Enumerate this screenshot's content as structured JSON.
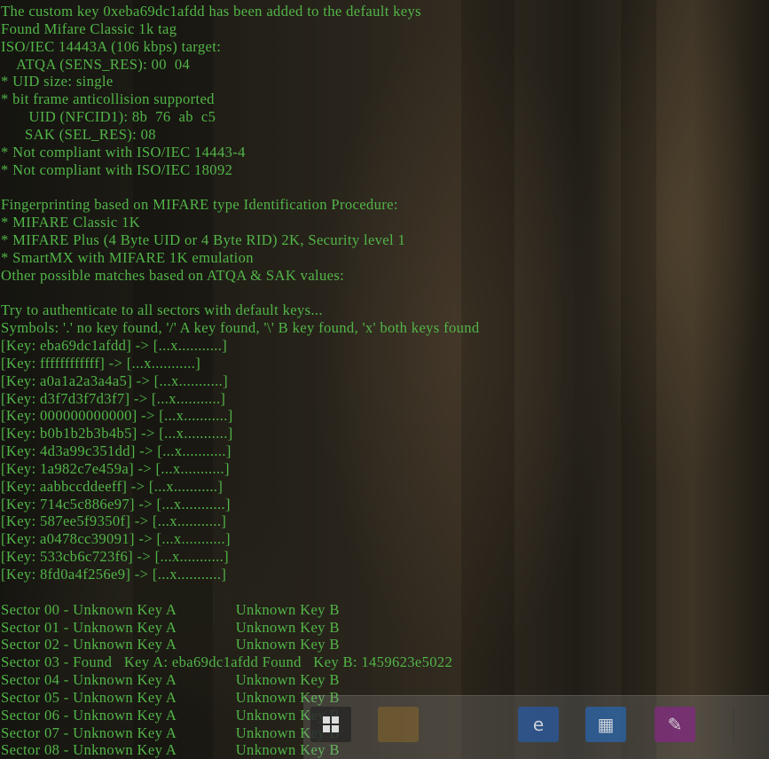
{
  "colors": {
    "terminal_text": "#52b548",
    "background_photo": "tree-bark"
  },
  "terminal": {
    "lines": [
      "The custom key 0xeba69dc1afdd has been added to the default keys",
      "Found Mifare Classic 1k tag",
      "ISO/IEC 14443A (106 kbps) target:",
      "    ATQA (SENS_RES): 00  04",
      "* UID size: single",
      "* bit frame anticollision supported",
      "       UID (NFCID1): 8b  76  ab  c5",
      "      SAK (SEL_RES): 08",
      "* Not compliant with ISO/IEC 14443-4",
      "* Not compliant with ISO/IEC 18092",
      "",
      "Fingerprinting based on MIFARE type Identification Procedure:",
      "* MIFARE Classic 1K",
      "* MIFARE Plus (4 Byte UID or 4 Byte RID) 2K, Security level 1",
      "* SmartMX with MIFARE 1K emulation",
      "Other possible matches based on ATQA & SAK values:",
      "",
      "Try to authenticate to all sectors with default keys...",
      "Symbols: '.' no key found, '/' A key found, '\\' B key found, 'x' both keys found",
      "[Key: eba69dc1afdd] -> [...x...........]",
      "[Key: ffffffffffff] -> [...x...........]",
      "[Key: a0a1a2a3a4a5] -> [...x...........]",
      "[Key: d3f7d3f7d3f7] -> [...x...........]",
      "[Key: 000000000000] -> [...x...........]",
      "[Key: b0b1b2b3b4b5] -> [...x...........]",
      "[Key: 4d3a99c351dd] -> [...x...........]",
      "[Key: 1a982c7e459a] -> [...x...........]",
      "[Key: aabbccddeeff] -> [...x...........]",
      "[Key: 714c5c886e97] -> [...x...........]",
      "[Key: 587ee5f9350f] -> [...x...........]",
      "[Key: a0478cc39091] -> [...x...........]",
      "[Key: 533cb6c723f6] -> [...x...........]",
      "[Key: 8fd0a4f256e9] -> [...x...........]",
      "",
      "Sector 00 - Unknown Key A               Unknown Key B",
      "Sector 01 - Unknown Key A               Unknown Key B",
      "Sector 02 - Unknown Key A               Unknown Key B",
      "Sector 03 - Found   Key A: eba69dc1afdd Found   Key B: 1459623e5022",
      "Sector 04 - Unknown Key A               Unknown Key B",
      "Sector 05 - Unknown Key A               Unknown Key B",
      "Sector 06 - Unknown Key A               Unknown Key B",
      "Sector 07 - Unknown Key A               Unknown Key B",
      "Sector 08 - Unknown Key A               Unknown Key B"
    ]
  },
  "taskbar": {
    "icons": [
      {
        "name": "start-icon"
      },
      {
        "name": "app-icon"
      },
      {
        "name": "ie-icon",
        "glyph": "e"
      },
      {
        "name": "app-icon"
      },
      {
        "name": "tools-icon",
        "glyph": "✎"
      }
    ]
  }
}
